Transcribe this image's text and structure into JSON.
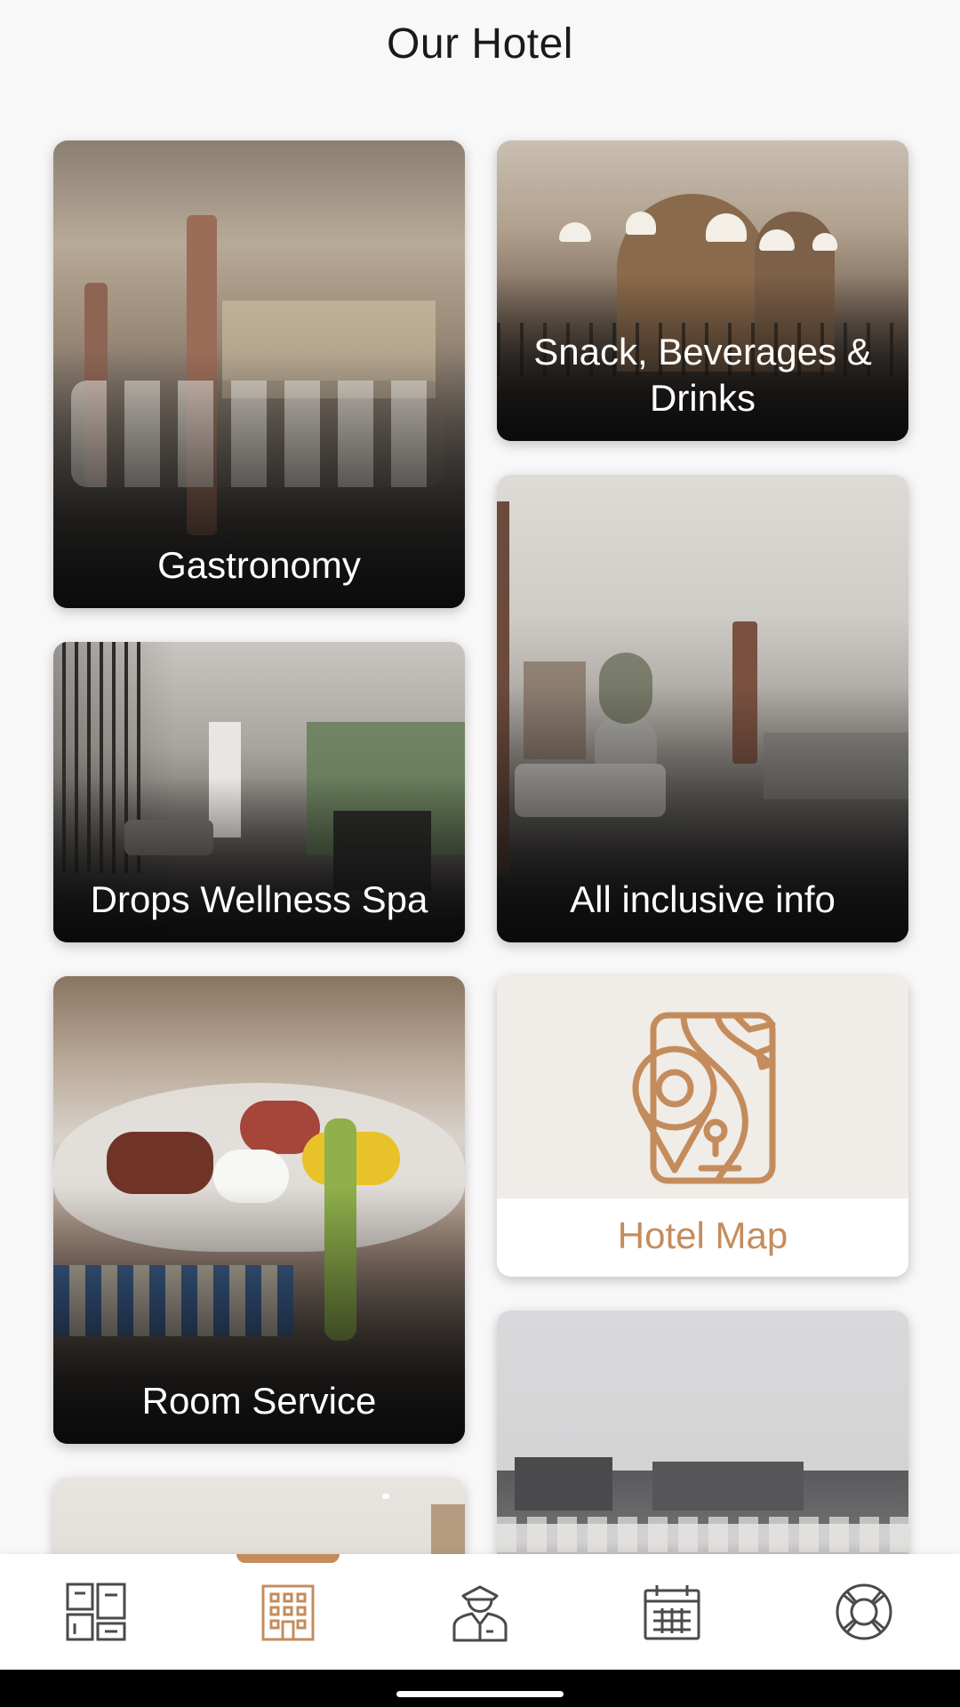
{
  "header": {
    "title": "Our Hotel"
  },
  "cards": {
    "gastronomy": {
      "label": "Gastronomy"
    },
    "snack": {
      "label": "Snack, Beverages & Drinks"
    },
    "spa": {
      "label": "Drops Wellness Spa"
    },
    "all_inclusive": {
      "label": "All inclusive info"
    },
    "room_service": {
      "label": "Room Service"
    },
    "hotel_map": {
      "label": "Hotel Map",
      "icon": "map-pin-icon"
    },
    "partial_lounge": {
      "label": ""
    },
    "partial_beach": {
      "label": ""
    }
  },
  "bottom_nav": {
    "active_index": 1,
    "items": [
      {
        "icon": "dashboard-icon"
      },
      {
        "icon": "hotel-building-icon"
      },
      {
        "icon": "concierge-icon"
      },
      {
        "icon": "calendar-icon"
      },
      {
        "icon": "lifebuoy-icon"
      }
    ]
  },
  "colors": {
    "accent": "#c48c5c",
    "nav_icon": "#4a4a4a",
    "background": "#f9f8f8"
  }
}
